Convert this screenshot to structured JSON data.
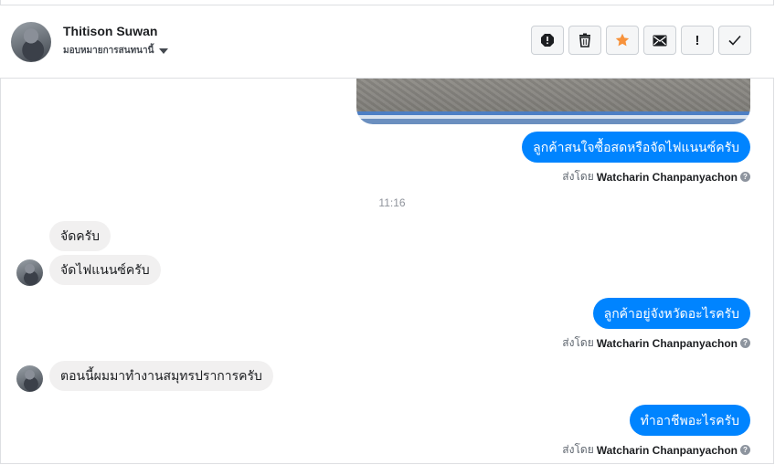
{
  "header": {
    "name": "Thitison Suwan",
    "assign_label": "มอบหมายการสนทนานี้",
    "actions": {
      "alert": "alert-icon",
      "trash": "trash-icon",
      "star": "star-icon",
      "mail": "mail-icon",
      "important": "!",
      "done": "check-icon"
    },
    "star_color": "#f7923b"
  },
  "messages": {
    "m1": {
      "text": "ลูกค้าสนใจซื้อสดหรือจัดไฟแนนซ์ครับ",
      "sent_prefix": "ส่งโดย",
      "sender": "Watcharin Chanpanyachon"
    },
    "time": "11:16",
    "m2": {
      "text": "จัดครับ"
    },
    "m3": {
      "text": "จัดไฟแนนซ์ครับ"
    },
    "m4": {
      "text": "ลูกค้าอยู่จังหวัดอะไรครับ",
      "sent_prefix": "ส่งโดย",
      "sender": "Watcharin Chanpanyachon"
    },
    "m5": {
      "text": "ตอนนี้ผมมาทำงานสมุทรปราการครับ"
    },
    "m6": {
      "text": "ทำอาชีพอะไรครับ",
      "sent_prefix": "ส่งโดย",
      "sender": "Watcharin Chanpanyachon"
    }
  },
  "colors": {
    "outgoing": "#0084ff",
    "incoming": "#f1f0f0"
  }
}
